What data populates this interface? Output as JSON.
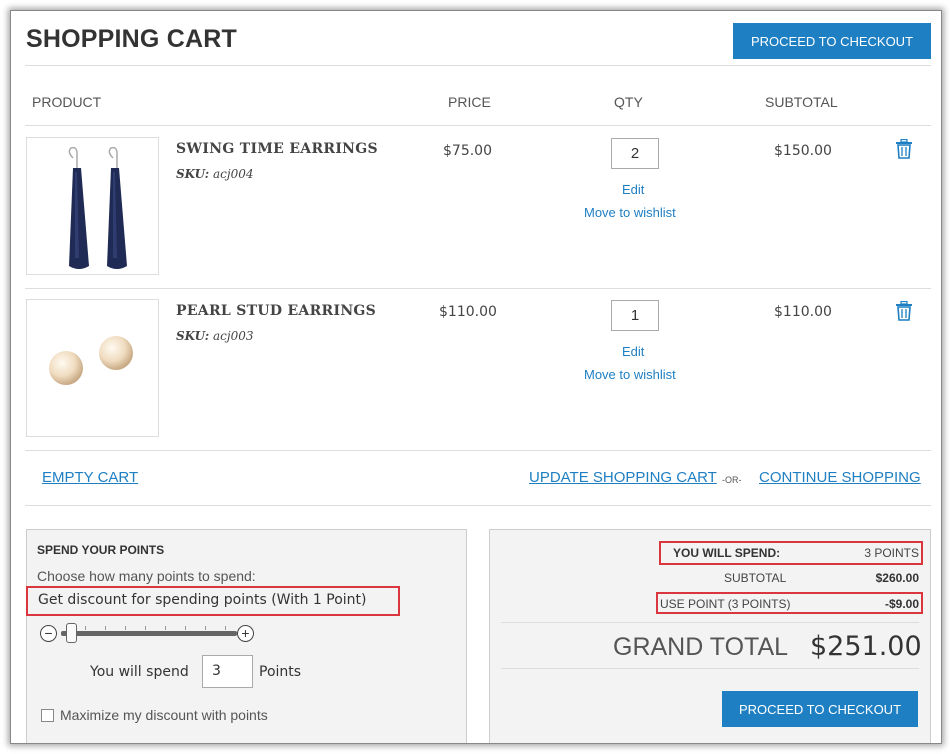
{
  "header": {
    "title": "SHOPPING CART",
    "checkout_label": "PROCEED TO CHECKOUT"
  },
  "table": {
    "columns": [
      "PRODUCT",
      "PRICE",
      "QTY",
      "SUBTOTAL"
    ]
  },
  "items": [
    {
      "name": "SWING TIME EARRINGS",
      "sku_label": "SKU:",
      "sku": "acj004",
      "price": "$75.00",
      "qty": "2",
      "edit": "Edit",
      "wishlist": "Move to wishlist",
      "subtotal": "$150.00",
      "image": "navy-drop-earrings"
    },
    {
      "name": "PEARL STUD EARRINGS",
      "sku_label": "SKU:",
      "sku": "acj003",
      "price": "$110.00",
      "qty": "1",
      "edit": "Edit",
      "wishlist": "Move to wishlist",
      "subtotal": "$110.00",
      "image": "pearl-stud-earrings"
    }
  ],
  "actions": {
    "empty_cart": "EMPTY CART",
    "update_cart": "UPDATE SHOPPING CART",
    "or": "-OR-",
    "continue": "CONTINUE SHOPPING"
  },
  "points": {
    "title": "SPEND YOUR POINTS",
    "choose": "Choose how many points to spend:",
    "discount_rule": "Get discount for spending points (With 1 Point)",
    "minus": "−",
    "plus": "+",
    "spend_prefix": "You will spend",
    "spend_value": "3",
    "spend_suffix": "Points",
    "maximize_label": "Maximize my discount with points",
    "maximize_checked": false
  },
  "totals": {
    "you_will_spend_label": "YOU WILL SPEND:",
    "you_will_spend_value": "3 POINTS",
    "subtotal_label": "SUBTOTAL",
    "subtotal_value": "$260.00",
    "use_point_label": "USE POINT (3 POINTS)",
    "use_point_value": "-$9.00",
    "grand_total_label": "GRAND TOTAL",
    "grand_total_value": "$251.00",
    "checkout_label": "PROCEED TO CHECKOUT"
  },
  "colors": {
    "accent": "#1e7fc3",
    "highlight": "#d9363e"
  }
}
